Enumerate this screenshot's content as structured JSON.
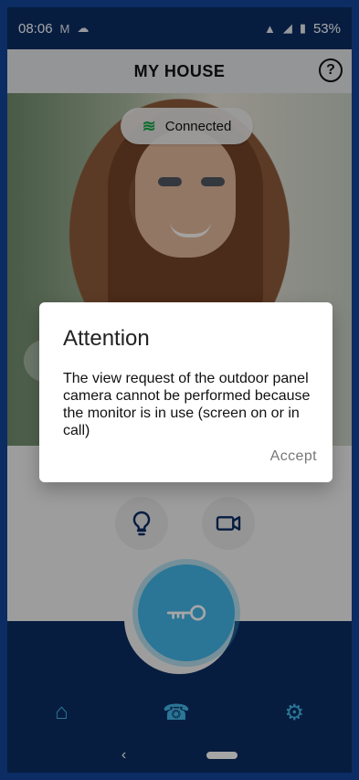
{
  "status": {
    "time": "08:06",
    "battery": "53%"
  },
  "header": {
    "title": "MY HOUSE"
  },
  "camera": {
    "connection": "Connected"
  },
  "dialog": {
    "title": "Attention",
    "message": "The view request of the outdoor panel camera cannot be performed because the monitor is in use (screen on or in call)",
    "accept": "Accept"
  },
  "colors": {
    "navy": "#0b2d63",
    "accent": "#43b6e6"
  },
  "icons": {
    "back": "chevron-left-icon",
    "help": "help-icon",
    "wifi": "wifi-icon",
    "light": "bulb-icon",
    "video": "video-camera-icon",
    "key": "key-icon",
    "home": "home-icon",
    "calls": "call-history-icon",
    "settings": "settings-icon"
  }
}
